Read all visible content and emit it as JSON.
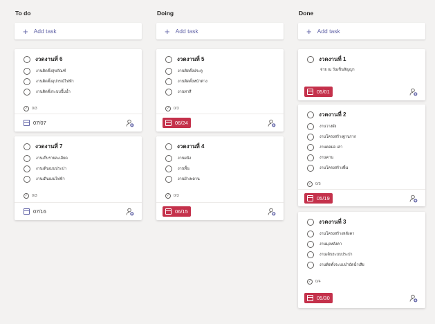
{
  "colors": {
    "accent": "#6264a7",
    "late": "#c4314b",
    "background": "#f3f2f1"
  },
  "add_task": {
    "label": "Add task",
    "icon": "plus-icon"
  },
  "buckets": [
    {
      "name": "To do",
      "cards": [
        {
          "title": "งวดงานที่ 6",
          "checklist": [
            "งานติดตั้งสุขภัณฑ์",
            "งานติดตั้งอุปกรณ์ไฟฟ้า",
            "งานติดตั้งระบบปั๊มน้ำ"
          ],
          "progress": "0/3",
          "due": "07/07",
          "late": false
        },
        {
          "title": "งวดงานที่ 7",
          "checklist": [
            "งานเก็บรายละเอียด",
            "งานเดินเมนประปา",
            "งานเดินเมนไฟฟ้า"
          ],
          "progress": "0/3",
          "due": "07/16",
          "late": false
        }
      ]
    },
    {
      "name": "Doing",
      "cards": [
        {
          "title": "งวดงานที่ 5",
          "checklist": [
            "งานติดตั้งประตู",
            "งานติดตั้งหน้าต่าง",
            "งานทาสี"
          ],
          "progress": "0/3",
          "due": "06/24",
          "late": true
        },
        {
          "title": "งวดงานที่ 4",
          "checklist": [
            "งานผนัง",
            "งานพื้น",
            "งานฝ้าเพดาน"
          ],
          "progress": "0/3",
          "due": "06/15",
          "late": true
        }
      ]
    },
    {
      "name": "Done",
      "cards": [
        {
          "title": "งวดงานที่ 1",
          "description": "จ่าย ณ วันเซ็นสัญญา",
          "due": "05/01",
          "late": true
        },
        {
          "title": "งวดงานที่ 2",
          "checklist": [
            "งานวางผัง",
            "งานโครงสร้างฐานราก",
            "งานตอม่อ เสา",
            "งานคาน",
            "งานโครงสร้างพื้น"
          ],
          "progress": "0/5",
          "due": "05/19",
          "late": true
        },
        {
          "title": "งวดงานที่ 3",
          "checklist": [
            "งานโครงสร้างหลังคา",
            "งานมุงหลังคา",
            "งานเดินระบบประปา",
            "งานติดตั้งระบบบำบัดน้ำเสีย"
          ],
          "progress": "0/4",
          "due": "05/30",
          "late": true
        }
      ]
    }
  ]
}
